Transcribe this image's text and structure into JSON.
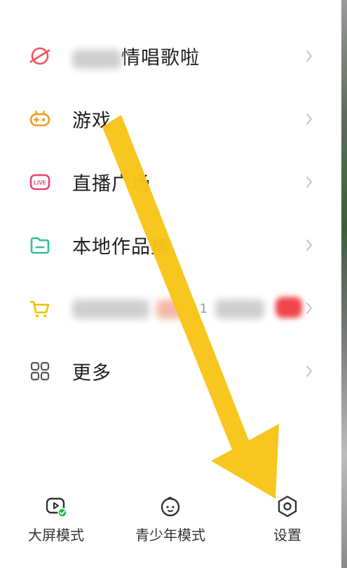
{
  "menu": {
    "items": [
      {
        "label": "情唱歌啦",
        "icon": "planet-icon"
      },
      {
        "label": "游戏",
        "icon": "gamepad-icon"
      },
      {
        "label": "直播广场",
        "icon": "live-icon"
      },
      {
        "label": "本地作品集",
        "icon": "folder-icon"
      },
      {
        "label": "11",
        "icon": "cart-icon"
      },
      {
        "label": "更多",
        "icon": "grid-icon"
      }
    ]
  },
  "bottom": {
    "items": [
      {
        "label": "大屏模式",
        "icon": "big-screen-icon"
      },
      {
        "label": "青少年模式",
        "icon": "teen-mode-icon"
      },
      {
        "label": "设置",
        "icon": "settings-icon"
      }
    ]
  },
  "colors": {
    "planet": "#f0545a",
    "gamepad": "#f39a2a",
    "live": "#e8436f",
    "folder": "#2fbf9a",
    "cart": "#f2c300",
    "grid": "#555555",
    "arrow": "#f7c418",
    "badge": "#1ec03a"
  }
}
